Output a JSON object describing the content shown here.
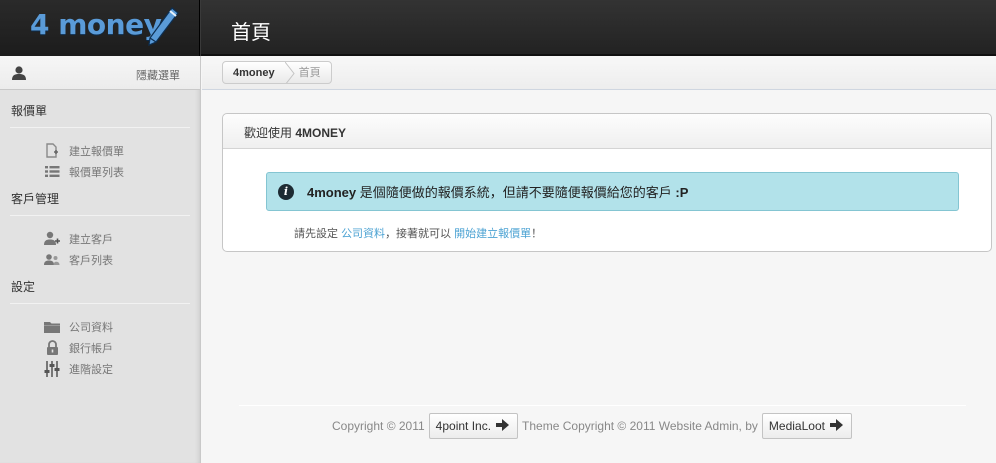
{
  "app": {
    "logo_text": "4 money",
    "page_title": "首頁"
  },
  "sidebar": {
    "hide_menu_label": "隱藏選單",
    "sections": [
      {
        "title": "報價單",
        "items": [
          {
            "label": "建立報價單",
            "icon": "new-document-icon"
          },
          {
            "label": "報價單列表",
            "icon": "list-icon"
          }
        ]
      },
      {
        "title": "客戶管理",
        "items": [
          {
            "label": "建立客戶",
            "icon": "add-user-icon"
          },
          {
            "label": "客戶列表",
            "icon": "users-icon"
          }
        ]
      },
      {
        "title": "設定",
        "items": [
          {
            "label": "公司資料",
            "icon": "folder-icon"
          },
          {
            "label": "銀行帳戶",
            "icon": "lock-icon"
          },
          {
            "label": "進階設定",
            "icon": "sliders-icon"
          }
        ]
      }
    ]
  },
  "breadcrumb": {
    "home": "4money",
    "current": "首頁"
  },
  "panel": {
    "title_prefix": "歡迎使用 ",
    "title_brand": "4MONEY",
    "alert": {
      "brand": "4money",
      "message": " 是個隨便做的報價系統，但請不要隨便報價給您的客戶 ",
      "emoticon": ":P"
    },
    "hint": {
      "prefix": "請先設定 ",
      "link1": "公司資料",
      "middle": "，接著就可以 ",
      "link2": "開始建立報價單",
      "suffix": "！"
    }
  },
  "footer": {
    "copyright": "Copyright © 2011",
    "company_button": "4point Inc.",
    "theme_text": "Theme Copyright © 2011 Website Admin, by",
    "theme_button": "MediaLoot"
  },
  "colors": {
    "accent": "#5a9bd8",
    "alert_bg": "#b2e2ea",
    "link": "#4da3d3"
  }
}
